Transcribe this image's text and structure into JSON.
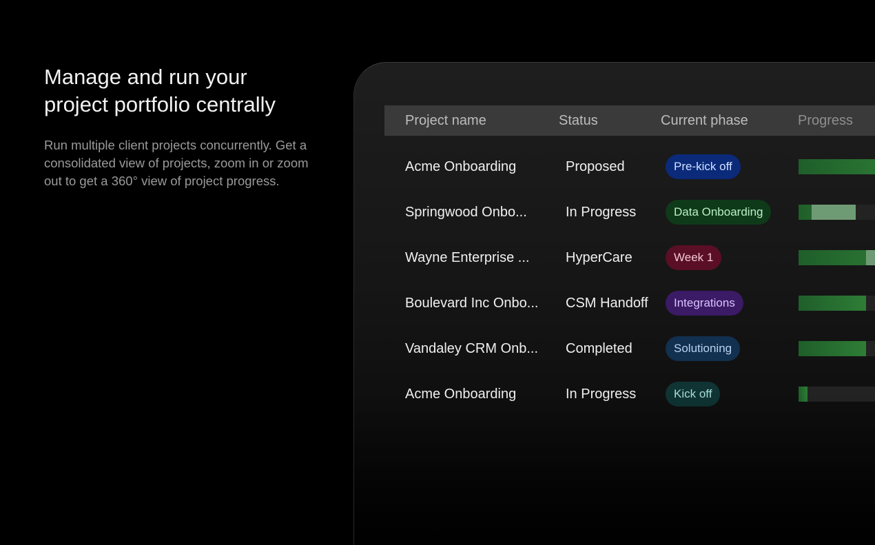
{
  "hero": {
    "title_line1": "Manage and run your",
    "title_line2": "project portfolio centrally",
    "description": "Run multiple client projects concurrently. Get a consolidated view of projects, zoom in or zoom out to get a 360° view of project progress."
  },
  "table": {
    "columns": {
      "name": "Project name",
      "status": "Status",
      "phase": "Current phase",
      "progress": "Progress"
    },
    "rows": [
      {
        "name": "Acme Onboarding",
        "status": "Proposed",
        "phase": "Pre-kick off",
        "phase_bg": "#0b2a7a",
        "phase_fg": "#cfe0ff",
        "progress": 1.0,
        "highlight_from": null,
        "highlight_to": null
      },
      {
        "name": "Springwood Onbo...",
        "status": "In Progress",
        "phase": "Data Onboarding",
        "phase_bg": "#0f3a1a",
        "phase_fg": "#b9f0c4",
        "progress": 0.52,
        "highlight_from": 0.12,
        "highlight_to": 0.52
      },
      {
        "name": "Wayne Enterprise ...",
        "status": "HyperCare",
        "phase": "Week 1",
        "phase_bg": "#5a0f26",
        "phase_fg": "#f3c7d2",
        "progress": 1.0,
        "highlight_from": 0.61,
        "highlight_to": 0.7
      },
      {
        "name": "Boulevard Inc Onbo...",
        "status": "CSM Handoff",
        "phase": "Integrations",
        "phase_bg": "#3b1a66",
        "phase_fg": "#d9c3ff",
        "progress": 0.61,
        "highlight_from": null,
        "highlight_to": null
      },
      {
        "name": "Vandaley CRM Onb...",
        "status": "Completed",
        "phase": "Solutioning",
        "phase_bg": "#12304f",
        "phase_fg": "#b9d3f0",
        "progress": 0.61,
        "highlight_from": null,
        "highlight_to": null
      },
      {
        "name": "Acme Onboarding",
        "status": "In Progress",
        "phase": "Kick off",
        "phase_bg": "#0f3433",
        "phase_fg": "#a8ddd6",
        "progress": 0.08,
        "highlight_from": null,
        "highlight_to": null
      }
    ]
  }
}
